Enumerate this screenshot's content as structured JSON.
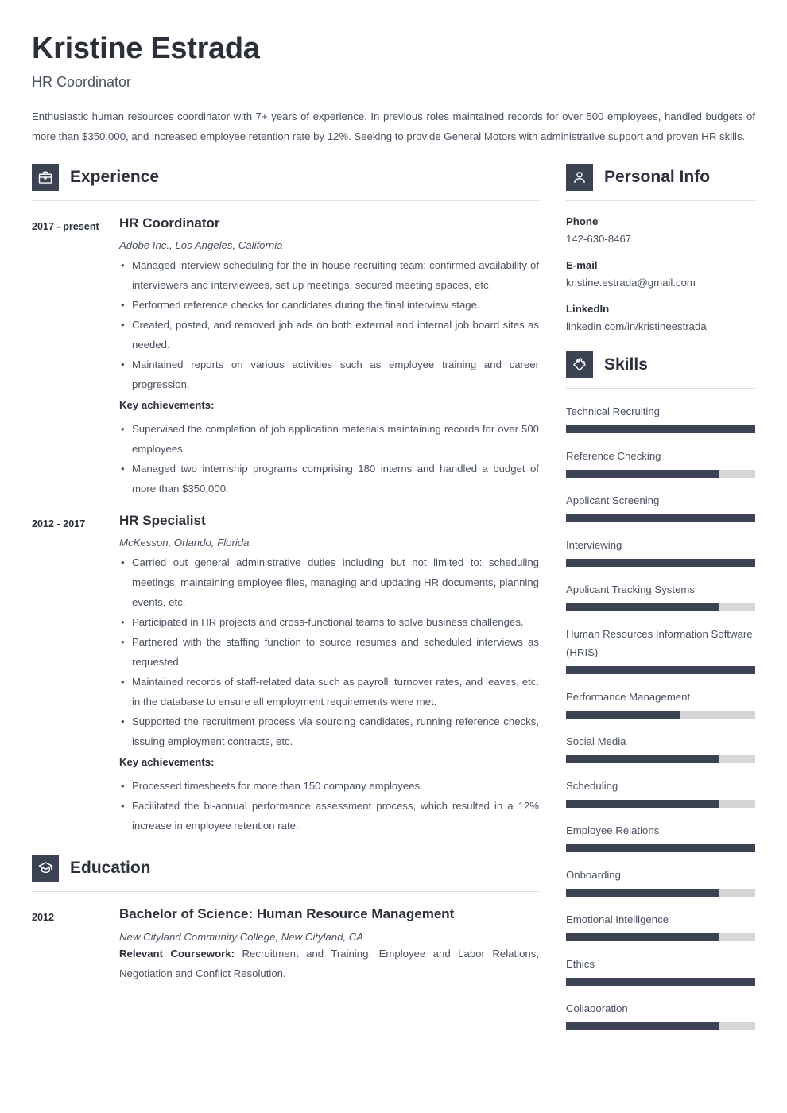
{
  "header": {
    "name": "Kristine Estrada",
    "job_title": "HR Coordinator",
    "summary": "Enthusiastic human resources coordinator with 7+ years of experience. In previous roles maintained records for over 500 employees, handled budgets of more than $350,000, and increased employee retention rate by 12%. Seeking to provide General Motors with administrative support and proven HR skills."
  },
  "experience": {
    "section_title": "Experience",
    "icon": "briefcase-icon",
    "entries": [
      {
        "date": "2017 - present",
        "role": "HR Coordinator",
        "org": "Adobe Inc., Los Angeles, California",
        "bullets": [
          "Managed interview scheduling for the in-house recruiting team: confirmed availability of interviewers and interviewees, set up meetings, secured meeting spaces, etc.",
          "Performed reference checks for candidates during the final interview stage.",
          "Created, posted, and removed job ads on both external and internal job board sites as needed.",
          "Maintained reports on various activities such as employee training and career progression."
        ],
        "key_achievements_label": "Key achievements:",
        "achievements": [
          "Supervised the completion of job application materials maintaining records for over 500 employees.",
          "Managed two internship programs comprising 180 interns and handled a budget of more than $350,000."
        ]
      },
      {
        "date": "2012 - 2017",
        "role": "HR Specialist",
        "org": "McKesson, Orlando, Florida",
        "bullets": [
          "Carried out general administrative duties including but not limited to: scheduling meetings, maintaining employee files, managing and updating HR documents, planning events, etc.",
          "Participated in HR projects and cross-functional teams to solve business challenges.",
          "Partnered with the staffing function to source resumes and scheduled interviews as requested.",
          "Maintained records of staff-related data such as payroll, turnover rates, and leaves, etc. in the database to ensure all employment requirements were met.",
          "Supported the recruitment process via sourcing candidates, running reference checks, issuing employment contracts, etc."
        ],
        "key_achievements_label": "Key achievements:",
        "achievements": [
          "Processed timesheets for more than 150 company employees.",
          "Facilitated the bi-annual performance assessment process, which resulted in a 12% increase in employee retention rate."
        ]
      }
    ]
  },
  "education": {
    "section_title": "Education",
    "icon": "graduation-cap-icon",
    "entries": [
      {
        "date": "2012",
        "degree": "Bachelor of Science: Human Resource Management",
        "school": "New Cityland Community College, New Cityland, CA",
        "coursework_label": "Relevant Coursework:",
        "coursework_value": "Recruitment and Training, Employee and Labor Relations, Negotiation and Conflict Resolution."
      }
    ]
  },
  "personal_info": {
    "section_title": "Personal Info",
    "icon": "person-icon",
    "fields": [
      {
        "label": "Phone",
        "value": "142-630-8467"
      },
      {
        "label": "E-mail",
        "value": "kristine.estrada@gmail.com"
      },
      {
        "label": "LinkedIn",
        "value": "linkedin.com/in/kristineestrada"
      }
    ]
  },
  "skills": {
    "section_title": "Skills",
    "icon": "puzzle-piece-icon",
    "items": [
      {
        "name": "Technical Recruiting",
        "level": 100
      },
      {
        "name": "Reference Checking",
        "level": 81
      },
      {
        "name": "Applicant Screening",
        "level": 100
      },
      {
        "name": "Interviewing",
        "level": 100
      },
      {
        "name": "Applicant Tracking Systems",
        "level": 81
      },
      {
        "name": "Human Resources Information Software (HRIS)",
        "level": 100
      },
      {
        "name": "Performance Management",
        "level": 60
      },
      {
        "name": "Social Media",
        "level": 81
      },
      {
        "name": "Scheduling",
        "level": 81
      },
      {
        "name": "Employee Relations",
        "level": 100
      },
      {
        "name": "Onboarding",
        "level": 81
      },
      {
        "name": "Emotional Intelligence",
        "level": 81
      },
      {
        "name": "Ethics",
        "level": 100
      },
      {
        "name": "Collaboration",
        "level": 81
      }
    ]
  },
  "colors": {
    "accent_dark": "#3b4252",
    "text_dark": "#2b303b",
    "text_body": "#4a5160",
    "bar_track": "#d4d6d8",
    "rule": "#dcdfe3"
  }
}
